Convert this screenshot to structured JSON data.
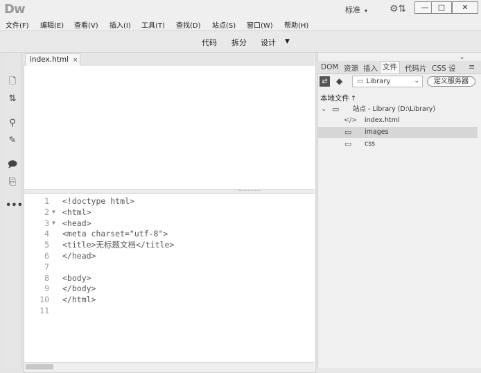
{
  "app": {
    "logo": "Dw",
    "workspace": "标准",
    "workspace_caret": "▾"
  },
  "window_controls": {
    "minimize": "—",
    "maximize": "□",
    "close": "✕"
  },
  "menu": [
    "文件(F)",
    "编辑(E)",
    "查看(V)",
    "插入(I)",
    "工具(T)",
    "查找(D)",
    "站点(S)",
    "窗口(W)",
    "帮助(H)"
  ],
  "view_modes": {
    "code": "代码",
    "split": "拆分",
    "design": "设计",
    "more": "▼"
  },
  "left_tools": [
    "new-file-icon",
    "sort-icon",
    "filter-icon",
    "brush-icon",
    "comment-icon",
    "snippet-icon",
    "more-icon"
  ],
  "document": {
    "tab_label": "index.html",
    "tab_close": "×",
    "code_lines": [
      {
        "n": "1",
        "fold": "",
        "text": "<!doctype html>"
      },
      {
        "n": "2",
        "fold": "▼",
        "text": "<html>"
      },
      {
        "n": "3",
        "fold": "▼",
        "text": "<head>"
      },
      {
        "n": "4",
        "fold": "",
        "text": "<meta charset=\"utf-8\">"
      },
      {
        "n": "5",
        "fold": "",
        "text": "<title>无标题文档</title>"
      },
      {
        "n": "6",
        "fold": "",
        "text": "</head>"
      },
      {
        "n": "7",
        "fold": "",
        "text": ""
      },
      {
        "n": "8",
        "fold": "",
        "text": "<body>"
      },
      {
        "n": "9",
        "fold": "",
        "text": "</body>"
      },
      {
        "n": "10",
        "fold": "",
        "text": "</html>"
      },
      {
        "n": "11",
        "fold": "",
        "text": ""
      }
    ]
  },
  "panel": {
    "collapse": "«",
    "menu_icon": "≡",
    "tabs": [
      "DOM",
      "资源",
      "插入",
      "文件",
      "代码片",
      "CSS 设"
    ],
    "active_tab": "文件",
    "site_select": "Library",
    "define_server": "定义服务器",
    "local_files": "本地文件",
    "local_files_arrow": "↑",
    "tree": [
      {
        "indent": 0,
        "toggle": "⌄",
        "icon": "folder-icon",
        "glyph": "▭",
        "label": "站点 - Library (D:\\Library)"
      },
      {
        "indent": 1,
        "toggle": "",
        "icon": "code-file-icon",
        "glyph": "</>",
        "label": "index.html"
      },
      {
        "indent": 1,
        "toggle": "",
        "icon": "folder-icon",
        "glyph": "▭",
        "label": "images",
        "selected": true
      },
      {
        "indent": 1,
        "toggle": "",
        "icon": "folder-icon",
        "glyph": "▭",
        "label": "css"
      }
    ]
  }
}
